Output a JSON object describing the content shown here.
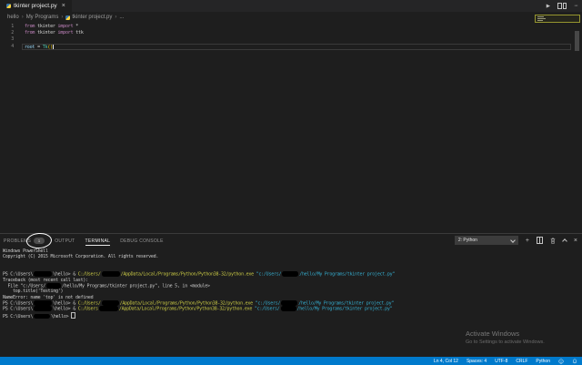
{
  "glyphs": {
    "run": "▶",
    "more": "···",
    "close": "×",
    "plus": "+"
  },
  "tab_bar": {
    "tab": {
      "label": "tkinter project.py",
      "icon": "python-icon"
    }
  },
  "breadcrumb": {
    "items": [
      {
        "label": "hello"
      },
      {
        "label": "My Programs"
      },
      {
        "label": "tkinter project.py",
        "icon": "python"
      },
      {
        "label": "..."
      }
    ]
  },
  "editor": {
    "lines": [
      {
        "no": "1",
        "segments": [
          {
            "t": "from ",
            "c": "kw"
          },
          {
            "t": "tkinter ",
            "c": "pl"
          },
          {
            "t": "import ",
            "c": "kw"
          },
          {
            "t": "*",
            "c": "pl"
          }
        ]
      },
      {
        "no": "2",
        "segments": [
          {
            "t": "from ",
            "c": "kw"
          },
          {
            "t": "tkinter ",
            "c": "pl"
          },
          {
            "t": "import ",
            "c": "kw"
          },
          {
            "t": "ttk",
            "c": "pl"
          }
        ]
      },
      {
        "no": "3",
        "segments": []
      },
      {
        "no": "4",
        "current": true,
        "segments": [
          {
            "t": "root ",
            "c": "var"
          },
          {
            "t": "= ",
            "c": "pl"
          },
          {
            "t": "Tk",
            "c": "cls"
          },
          {
            "t": "(",
            "c": "br"
          },
          {
            "t": ")",
            "c": "br"
          },
          {
            "cursor": true
          }
        ]
      }
    ]
  },
  "panel": {
    "tabs": [
      {
        "label": "PROBLEMS",
        "badge": "1",
        "annotated": true
      },
      {
        "label": "OUTPUT"
      },
      {
        "label": "TERMINAL",
        "active": true
      },
      {
        "label": "DEBUG CONSOLE"
      }
    ],
    "dropdown": {
      "value": "2: Python"
    }
  },
  "terminal": {
    "lines": [
      [
        {
          "t": "Windows PowerShell"
        }
      ],
      [
        {
          "t": "Copyright (C) 2015 Microsoft Corporation. All rights reserved."
        }
      ],
      [],
      [],
      [
        {
          "t": "PS C:\\Users\\"
        },
        {
          "r": 20
        },
        {
          "t": "\\hello> & "
        },
        {
          "t": "C:/Users/",
          "c": "y"
        },
        {
          "r": 20
        },
        {
          "t": "/AppData/Local/Programs/Python/Python38-32/python.exe ",
          "c": "y"
        },
        {
          "t": "\"c:/Users/",
          "c": "c"
        },
        {
          "r": 18
        },
        {
          "t": "/hello/My Programs/tkinter project.py\"",
          "c": "c"
        }
      ],
      [
        {
          "t": "Traceback (most recent call last):"
        }
      ],
      [
        {
          "t": "  File \"c:/Users/"
        },
        {
          "r": 16
        },
        {
          "t": "/hello/My Programs/tkinter project.py\", line 5, in <module>"
        }
      ],
      [
        {
          "t": "    top.title('Testing')"
        }
      ],
      [
        {
          "t": "NameError: name 'top' is not defined"
        }
      ],
      [
        {
          "t": "PS C:\\Users\\"
        },
        {
          "r": 20
        },
        {
          "t": "\\hello> & "
        },
        {
          "t": "C:/Users/",
          "c": "y"
        },
        {
          "r": 19
        },
        {
          "t": "/AppData/Local/Programs/Python/Python38-32/python.exe ",
          "c": "y"
        },
        {
          "t": "\"c:/Users/",
          "c": "c"
        },
        {
          "r": 18
        },
        {
          "t": "/hello/My Programs/tkinter project.py\"",
          "c": "c"
        }
      ],
      [
        {
          "t": "PS C:\\Users\\"
        },
        {
          "r": 20
        },
        {
          "t": "\\hello> & "
        },
        {
          "t": "C:/Users",
          "c": "y"
        },
        {
          "r": 21
        },
        {
          "t": "/AppData/Local/Programs/Python/Python38-32/python.exe ",
          "c": "y"
        },
        {
          "t": "\"c:/Users/",
          "c": "c"
        },
        {
          "r": 17
        },
        {
          "t": "/hello/My Programs/tkinter project.py\"",
          "c": "c"
        }
      ],
      [
        {
          "t": "PS C:\\Users\\"
        },
        {
          "r": 18
        },
        {
          "t": "\\hello> "
        },
        {
          "cur": true
        }
      ]
    ]
  },
  "watermark": {
    "title": "Activate Windows",
    "subtitle": "Go to Settings to activate Windows."
  },
  "status_bar": {
    "items": [
      "Ln 4, Col 12",
      "Spaces: 4",
      "UTF-8",
      "CRLF",
      "Python"
    ]
  },
  "colors": {
    "accent": "#007ACC",
    "editor_bg": "#1E1E1E",
    "tabbar_bg": "#252526",
    "keyword": "#C586C0",
    "variable": "#9CDCFE",
    "class": "#4EC9B0",
    "bracket": "#FFD700",
    "terminal_command": "#CACA45",
    "terminal_string": "#35AED0",
    "minimap_border": "#96962F"
  }
}
